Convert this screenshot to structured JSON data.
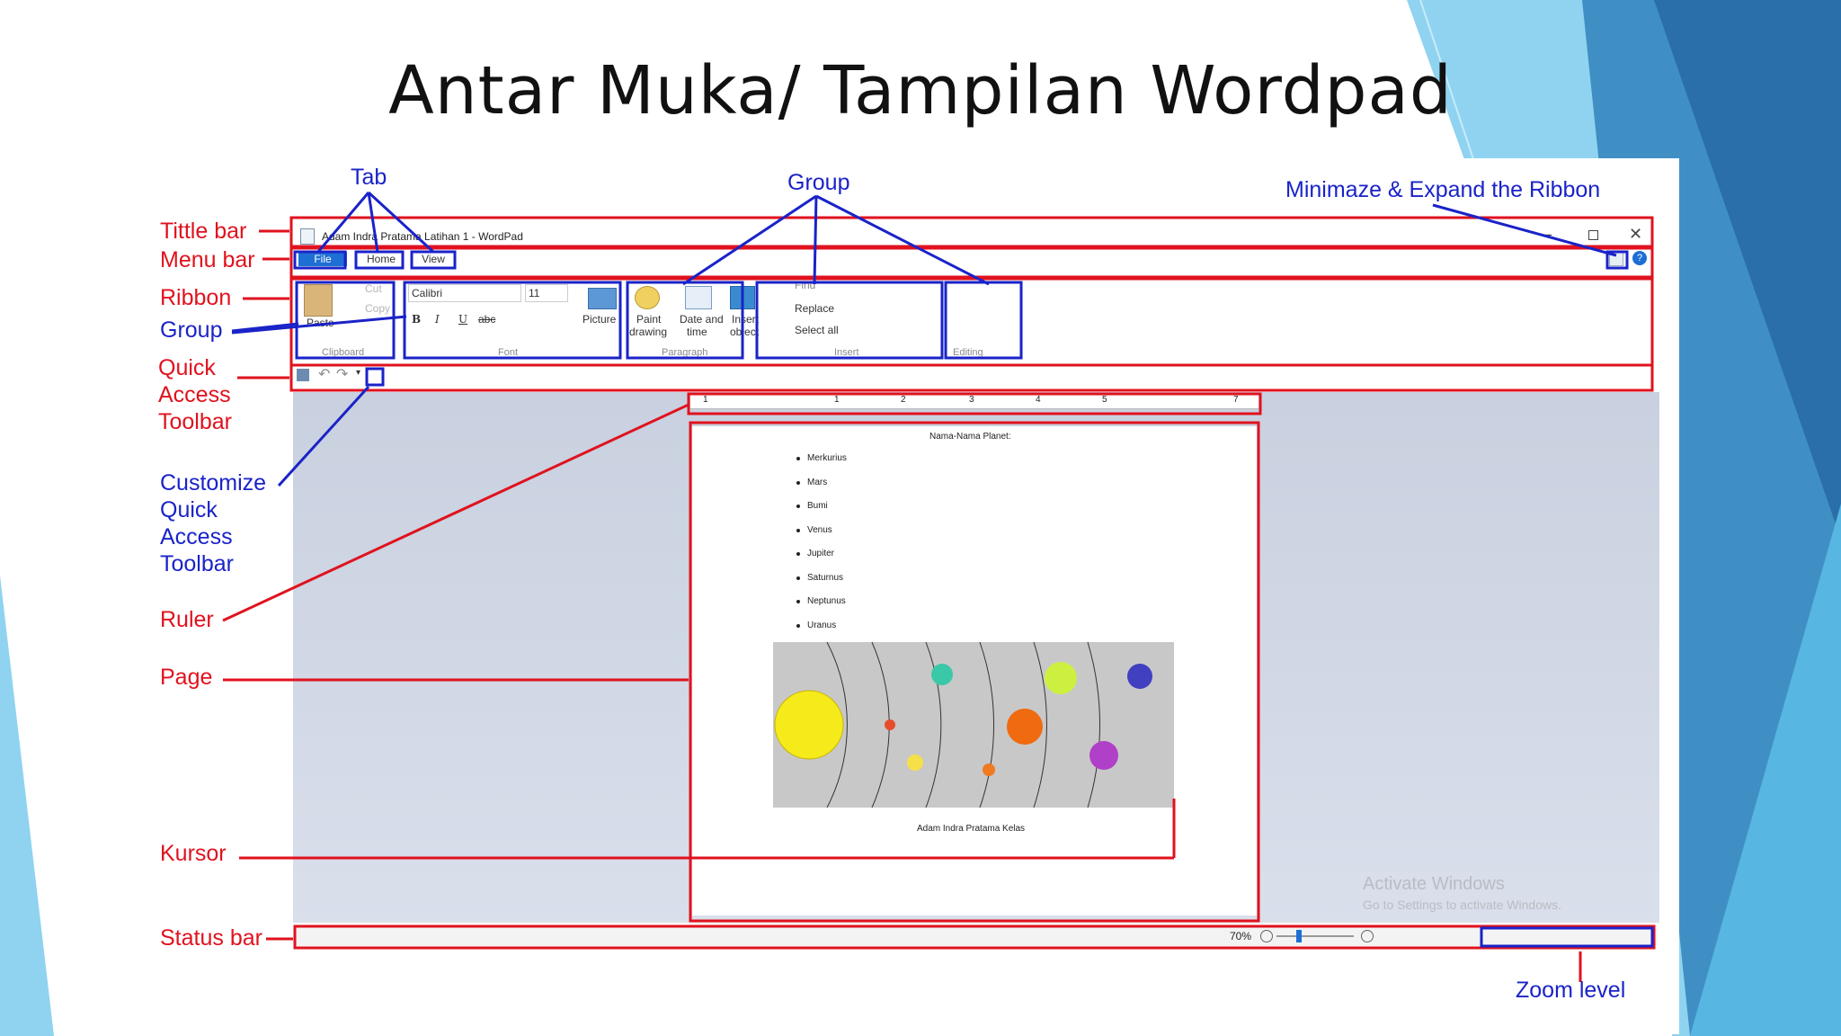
{
  "slide": {
    "title": "Antar Muka/ Tampilan Wordpad"
  },
  "annotations": {
    "title_bar": "Tittle bar",
    "menu_bar": "Menu bar",
    "ribbon": "Ribbon",
    "group_left": "Group",
    "quick_access": [
      "Quick",
      "Access",
      "Toolbar"
    ],
    "customize": [
      "Customize",
      "Quick",
      "Access",
      "Toolbar"
    ],
    "ruler": "Ruler",
    "page": "Page",
    "kursor": "Kursor",
    "status_bar": "Status bar",
    "tab": "Tab",
    "group_top": "Group",
    "minimize": "Minimaze & Expand the Ribbon",
    "zoom_level": "Zoom level"
  },
  "window": {
    "title": "Adam Indra Pratama Latihan 1 - WordPad",
    "tabs": [
      "File",
      "Home",
      "View"
    ],
    "colors": {
      "file_tab": "#1e6fd4",
      "annotation_red": "#e0121e",
      "annotation_blue": "#1a23c8"
    }
  },
  "ribbon": {
    "clipboard": {
      "paste": "Paste",
      "cut": "Cut",
      "copy": "Copy",
      "label": "Clipboard"
    },
    "font": {
      "family": "Calibri",
      "size": "11",
      "label": "Font",
      "bold": "B",
      "italic": "I",
      "underline": "U",
      "strike": "abc"
    },
    "paragraph": {
      "label": "Paragraph"
    },
    "insert": {
      "picture": "Picture",
      "paint": [
        "Paint",
        "drawing"
      ],
      "date": [
        "Date and",
        "time"
      ],
      "object": [
        "Insert",
        "object"
      ],
      "label": "Insert"
    },
    "editing": {
      "find": "Find",
      "replace": "Replace",
      "select_all": "Select all",
      "label": "Editing"
    }
  },
  "ruler": {
    "ticks": [
      "1",
      "1",
      "2",
      "3",
      "4",
      "5",
      "7"
    ]
  },
  "document": {
    "heading": "Nama-Nama  Planet:",
    "items": [
      "Merkurius",
      "Mars",
      "Bumi",
      "Venus",
      "Jupiter",
      "Saturnus",
      "Neptunus",
      "Uranus"
    ],
    "caption": "Adam  Indra  Pratama Kelas"
  },
  "status": {
    "zoom": "70%"
  },
  "watermark": {
    "line1": "Activate Windows",
    "line2": "Go to Settings to activate Windows."
  }
}
